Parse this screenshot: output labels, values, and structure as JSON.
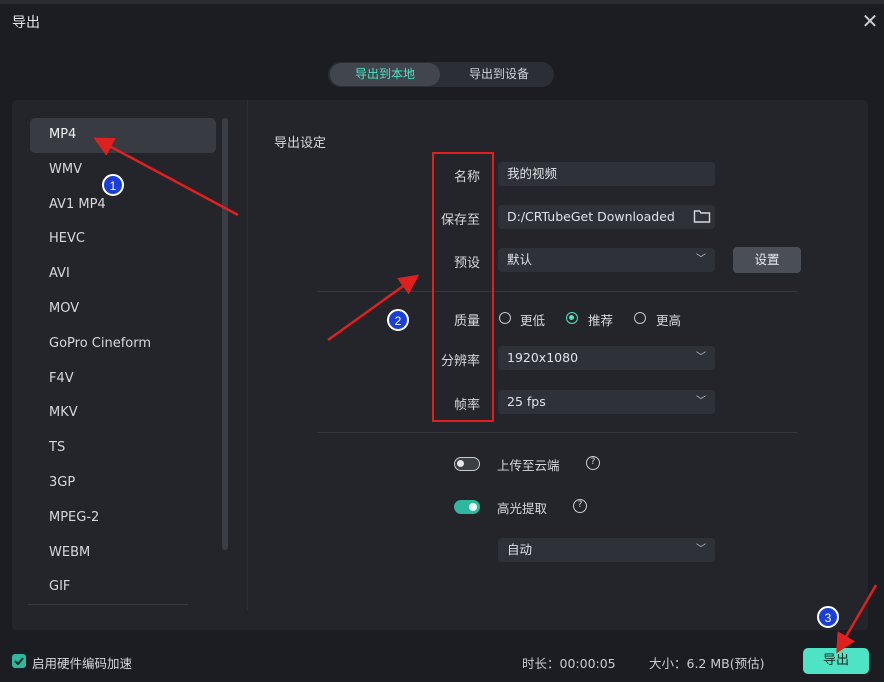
{
  "window": {
    "title": "导出"
  },
  "tabs": {
    "local": "导出到本地",
    "device": "导出到设备"
  },
  "formats": [
    "MP4",
    "WMV",
    "AV1 MP4",
    "HEVC",
    "AVI",
    "MOV",
    "GoPro Cineform",
    "F4V",
    "MKV",
    "TS",
    "3GP",
    "MPEG-2",
    "WEBM",
    "GIF"
  ],
  "settings": {
    "section_title": "导出设定",
    "name_label": "名称",
    "name_value": "我的视频",
    "save_label": "保存至",
    "save_value": "D:/CRTubeGet Downloaded",
    "preset_label": "预设",
    "preset_value": "默认",
    "preset_button": "设置",
    "quality_label": "质量",
    "quality_options": [
      "更低",
      "推荐",
      "更高"
    ],
    "resolution_label": "分辨率",
    "resolution_value": "1920x1080",
    "framerate_label": "帧率",
    "framerate_value": "25 fps",
    "cloud_label": "上传至云端",
    "highlight_label": "高光提取",
    "highlight_mode": "自动"
  },
  "footer": {
    "hw_accel": "启用硬件编码加速",
    "duration": "时长：00:00:05",
    "size": "大小：6.2 MB(预估)",
    "export_button": "导出"
  },
  "annotations": {
    "m1": "1",
    "m2": "2",
    "m3": "3"
  },
  "colors": {
    "accent": "#4fe3c5",
    "annotation_red": "#e0201e",
    "annotation_blue": "#1a3fd8"
  }
}
